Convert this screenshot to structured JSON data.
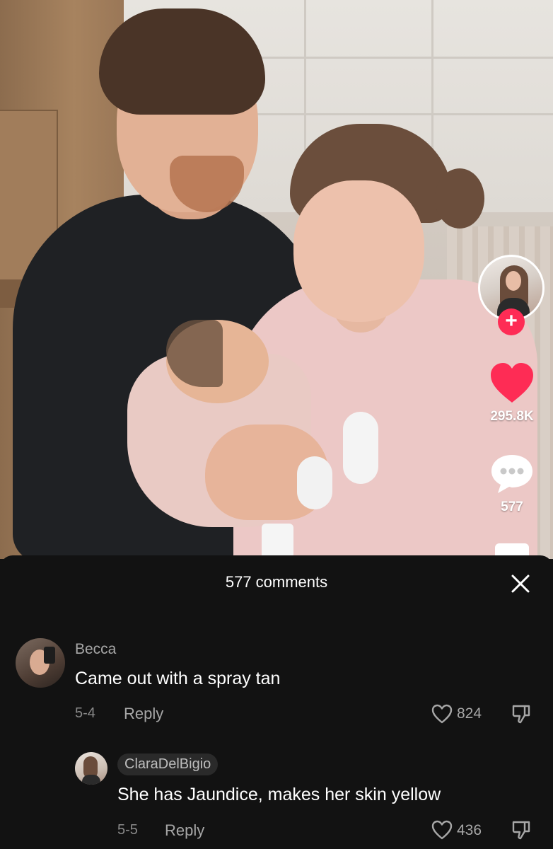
{
  "video": {
    "likes_count": "295.8K",
    "comments_count": "577"
  },
  "rail": {
    "follow_symbol": "+",
    "icons": [
      "creator-avatar",
      "plus-icon",
      "heart-icon",
      "comment-icon",
      "bookmark-icon"
    ]
  },
  "comments_sheet": {
    "title": "577 comments",
    "comments": [
      {
        "username": "Becca",
        "text": "Came out with a spray tan",
        "date": "5-4",
        "reply_label": "Reply",
        "likes": "824"
      },
      {
        "username": "ClaraDelBigio",
        "text": "She has Jaundice, makes her skin yellow",
        "date": "5-5",
        "reply_label": "Reply",
        "likes": "436"
      }
    ]
  },
  "colors": {
    "like_red": "#fe2c55",
    "sheet_bg": "#121212"
  }
}
